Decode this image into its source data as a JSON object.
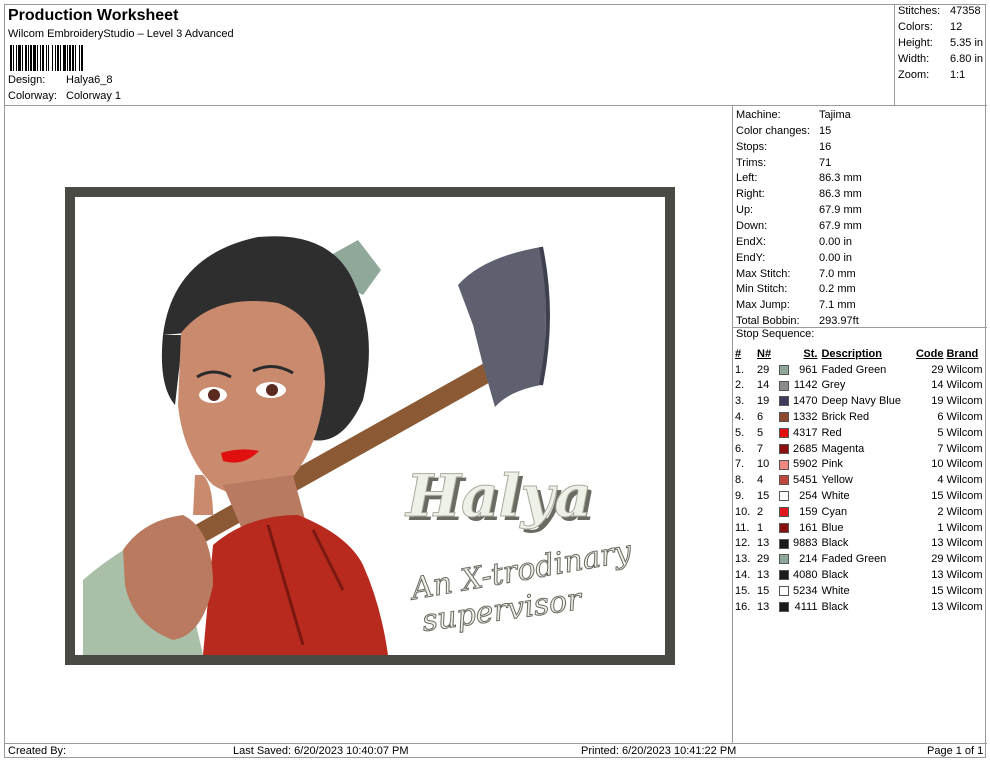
{
  "header": {
    "title": "Production Worksheet",
    "subtitle": "Wilcom EmbroideryStudio – Level 3 Advanced",
    "design_label": "Design:",
    "design_value": "Halya6_8",
    "colorway_label": "Colorway:",
    "colorway_value": "Colorway 1"
  },
  "summary": [
    {
      "label": "Stitches:",
      "value": "47358"
    },
    {
      "label": "Colors:",
      "value": "12"
    },
    {
      "label": "Height:",
      "value": "5.35 in"
    },
    {
      "label": "Width:",
      "value": "6.80 in"
    },
    {
      "label": "Zoom:",
      "value": "1:1"
    }
  ],
  "machine_info": [
    {
      "label": "Machine:",
      "value": "Tajima"
    },
    {
      "label": "Color changes:",
      "value": "15"
    },
    {
      "label": "Stops:",
      "value": "16"
    },
    {
      "label": "Trims:",
      "value": "71"
    },
    {
      "label": "Left:",
      "value": "86.3 mm"
    },
    {
      "label": "Right:",
      "value": "86.3 mm"
    },
    {
      "label": "Up:",
      "value": "67.9 mm"
    },
    {
      "label": "Down:",
      "value": "67.9 mm"
    },
    {
      "label": "EndX:",
      "value": "0.00 in"
    },
    {
      "label": "EndY:",
      "value": "0.00 in"
    },
    {
      "label": "Max Stitch:",
      "value": "7.0 mm"
    },
    {
      "label": "Min Stitch:",
      "value": "0.2 mm"
    },
    {
      "label": "Max Jump:",
      "value": "7.1 mm"
    },
    {
      "label": "Total Bobbin:",
      "value": "293.97ft"
    }
  ],
  "stop_sequence": {
    "title": "Stop Sequence:",
    "headers": {
      "idx": "#",
      "n": "N#",
      "st": "St.",
      "desc": "Description",
      "code": "Code",
      "brand": "Brand"
    },
    "rows": [
      {
        "idx": "1.",
        "n": "29",
        "color": "#8fa89a",
        "st": "961",
        "desc": "Faded Green",
        "code": "29",
        "brand": "Wilcom"
      },
      {
        "idx": "2.",
        "n": "14",
        "color": "#8c8c8c",
        "st": "1142",
        "desc": "Grey",
        "code": "14",
        "brand": "Wilcom"
      },
      {
        "idx": "3.",
        "n": "19",
        "color": "#3c3c5a",
        "st": "1470",
        "desc": "Deep Navy Blue",
        "code": "19",
        "brand": "Wilcom"
      },
      {
        "idx": "4.",
        "n": "6",
        "color": "#8b4a2e",
        "st": "1332",
        "desc": "Brick Red",
        "code": "6",
        "brand": "Wilcom"
      },
      {
        "idx": "5.",
        "n": "5",
        "color": "#e01010",
        "st": "4317",
        "desc": "Red",
        "code": "5",
        "brand": "Wilcom"
      },
      {
        "idx": "6.",
        "n": "7",
        "color": "#8a1010",
        "st": "2685",
        "desc": "Magenta",
        "code": "7",
        "brand": "Wilcom"
      },
      {
        "idx": "7.",
        "n": "10",
        "color": "#f08a80",
        "st": "5902",
        "desc": "Pink",
        "code": "10",
        "brand": "Wilcom"
      },
      {
        "idx": "8.",
        "n": "4",
        "color": "#c0463a",
        "st": "5451",
        "desc": "Yellow",
        "code": "4",
        "brand": "Wilcom"
      },
      {
        "idx": "9.",
        "n": "15",
        "color": "#ffffff",
        "st": "254",
        "desc": "White",
        "code": "15",
        "brand": "Wilcom"
      },
      {
        "idx": "10.",
        "n": "2",
        "color": "#e01818",
        "st": "159",
        "desc": "Cyan",
        "code": "2",
        "brand": "Wilcom"
      },
      {
        "idx": "11.",
        "n": "1",
        "color": "#8a1010",
        "st": "161",
        "desc": "Blue",
        "code": "1",
        "brand": "Wilcom"
      },
      {
        "idx": "12.",
        "n": "13",
        "color": "#1a1a1a",
        "st": "9883",
        "desc": "Black",
        "code": "13",
        "brand": "Wilcom"
      },
      {
        "idx": "13.",
        "n": "29",
        "color": "#8fa89a",
        "st": "214",
        "desc": "Faded Green",
        "code": "29",
        "brand": "Wilcom"
      },
      {
        "idx": "14.",
        "n": "13",
        "color": "#1a1a1a",
        "st": "4080",
        "desc": "Black",
        "code": "13",
        "brand": "Wilcom"
      },
      {
        "idx": "15.",
        "n": "15",
        "color": "#ffffff",
        "st": "5234",
        "desc": "White",
        "code": "15",
        "brand": "Wilcom"
      },
      {
        "idx": "16.",
        "n": "13",
        "color": "#1a1a1a",
        "st": "4111",
        "desc": "Black",
        "code": "13",
        "brand": "Wilcom"
      }
    ]
  },
  "design_text": {
    "name": "Halya",
    "line1": "An X-trodinary",
    "line2": "supervisor"
  },
  "footer": {
    "created": "Created By:",
    "last_saved": "Last Saved: 6/20/2023 10:40:07 PM",
    "printed": "Printed: 6/20/2023 10:41:22 PM",
    "page": "Page 1 of 1"
  }
}
